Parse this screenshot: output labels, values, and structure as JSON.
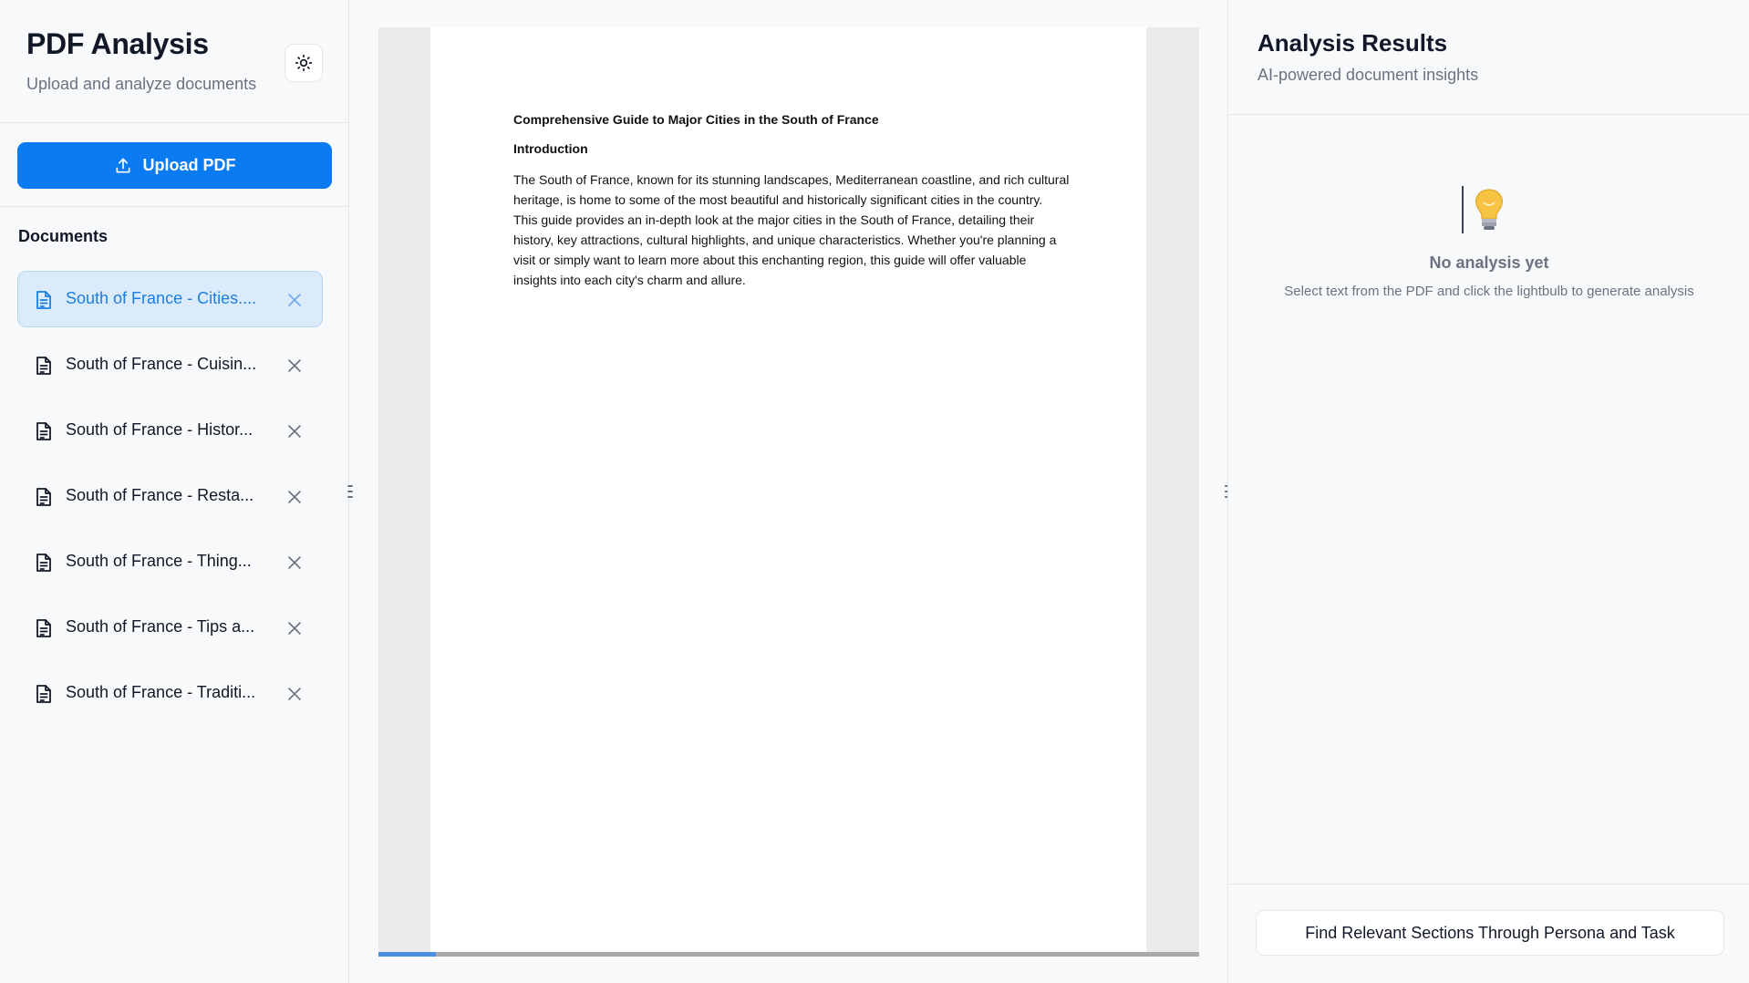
{
  "sidebar": {
    "title": "PDF Analysis",
    "subtitle": "Upload and analyze documents",
    "theme_toggle_icon": "sun-icon",
    "upload_label": "Upload PDF",
    "documents_heading": "Documents",
    "documents": [
      {
        "label": "South of France - Cities....",
        "active": true
      },
      {
        "label": "South of France - Cuisin...",
        "active": false
      },
      {
        "label": "South of France - Histor...",
        "active": false
      },
      {
        "label": "South of France - Resta...",
        "active": false
      },
      {
        "label": "South of France - Thing...",
        "active": false
      },
      {
        "label": "South of France - Tips a...",
        "active": false
      },
      {
        "label": "South of France - Traditi...",
        "active": false
      }
    ]
  },
  "viewer": {
    "doc_title": "Comprehensive Guide to Major Cities in the South of France",
    "section_heading": "Introduction",
    "body": "The South of France, known for its stunning landscapes, Mediterranean coastline, and rich cultural heritage, is home to some of the most beautiful and historically significant cities in the country. This guide provides an in-depth look at the major cities in the South of France, detailing their history, key attractions, cultural highlights, and unique characteristics. Whether you're planning a visit or simply want to learn more about this enchanting region, this guide will offer valuable insights into each city's charm and allure."
  },
  "analysis": {
    "title": "Analysis Results",
    "subtitle": "AI-powered document insights",
    "empty_icon": "lightbulb-icon",
    "empty_title": "No analysis yet",
    "empty_subtitle": "Select text from the PDF and click the lightbulb to generate analysis",
    "find_button": "Find Relevant Sections Through Persona and Task"
  },
  "colors": {
    "accent": "#0b7bf2",
    "active_bg": "#dcebfc",
    "active_text": "#1a7fe0"
  }
}
